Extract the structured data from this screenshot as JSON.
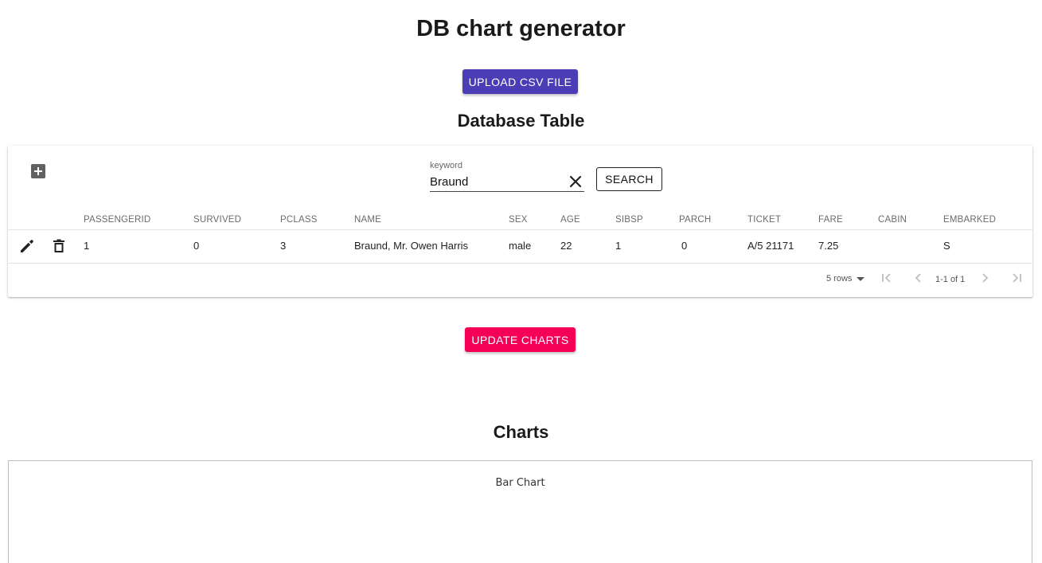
{
  "app": {
    "title": "DB chart generator"
  },
  "upload": {
    "label": "UPLOAD CSV FILE"
  },
  "database": {
    "title": "Database Table"
  },
  "search": {
    "label": "keyword",
    "value": "Braund",
    "button_label": "SEARCH"
  },
  "table": {
    "columns": [
      "PASSENGERID",
      "SURVIVED",
      "PCLASS",
      "NAME",
      "SEX",
      "AGE",
      "SIBSP",
      "PARCH",
      "TICKET",
      "FARE",
      "CABIN",
      "EMBARKED"
    ],
    "rows": [
      [
        "1",
        "0",
        "3",
        "Braund, Mr. Owen Harris",
        "male",
        "22",
        "1",
        "0",
        "A/5 21171",
        "7.25",
        "",
        "S"
      ]
    ]
  },
  "pagination": {
    "rows_per_page": "5 rows",
    "page_info": "1-1 of 1"
  },
  "update": {
    "label": "UPDATE CHARTS"
  },
  "charts": {
    "title": "Charts",
    "chart_title": "Bar Chart"
  },
  "colors": {
    "upload_button": "#4a3db5",
    "update_button": "#f50057"
  }
}
